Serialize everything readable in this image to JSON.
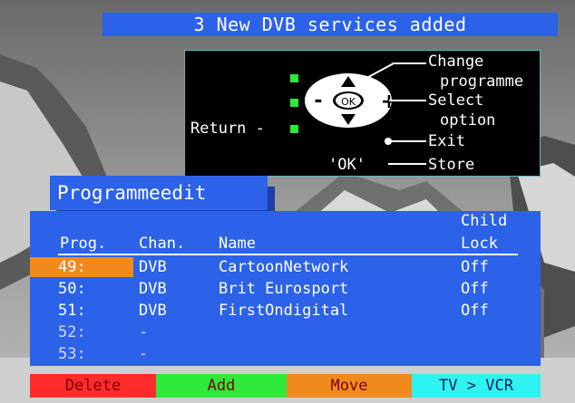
{
  "banner": {
    "text": "3 New DVB services added"
  },
  "help": {
    "change_line1": "Change",
    "change_line2": "programme",
    "select_line1": "Select",
    "select_line2": "option",
    "exit": "Exit",
    "return": "Return -",
    "ok_key": "'OK'",
    "store": "Store",
    "ok_button": "OK",
    "minus": "-",
    "plus": "+"
  },
  "title": "Programmeedit",
  "columns": {
    "prog": "Prog.",
    "chan": "Chan.",
    "name": "Name",
    "child_line1": "Child",
    "child_line2": "Lock"
  },
  "rows": [
    {
      "prog": "49:",
      "chan": "DVB",
      "name": "CartoonNetwork",
      "lock": "Off",
      "selected": true
    },
    {
      "prog": "50:",
      "chan": "DVB",
      "name": "Brit Eurosport",
      "lock": "Off",
      "selected": false
    },
    {
      "prog": "51:",
      "chan": "DVB",
      "name": "FirstOndigital",
      "lock": "Off",
      "selected": false
    },
    {
      "prog": "52:",
      "chan": "-",
      "name": "",
      "lock": "",
      "selected": false
    },
    {
      "prog": "53:",
      "chan": "-",
      "name": "",
      "lock": "",
      "selected": false
    }
  ],
  "function_keys": [
    {
      "label": "Delete",
      "color": "#ff2a2a"
    },
    {
      "label": "Add",
      "color": "#2ee83a"
    },
    {
      "label": "Move",
      "color": "#f08a1d"
    },
    {
      "label": "TV > VCR",
      "color": "#2ff2f2"
    }
  ],
  "colors": {
    "panel": "#2c62e8",
    "highlight": "#f08a1d"
  }
}
